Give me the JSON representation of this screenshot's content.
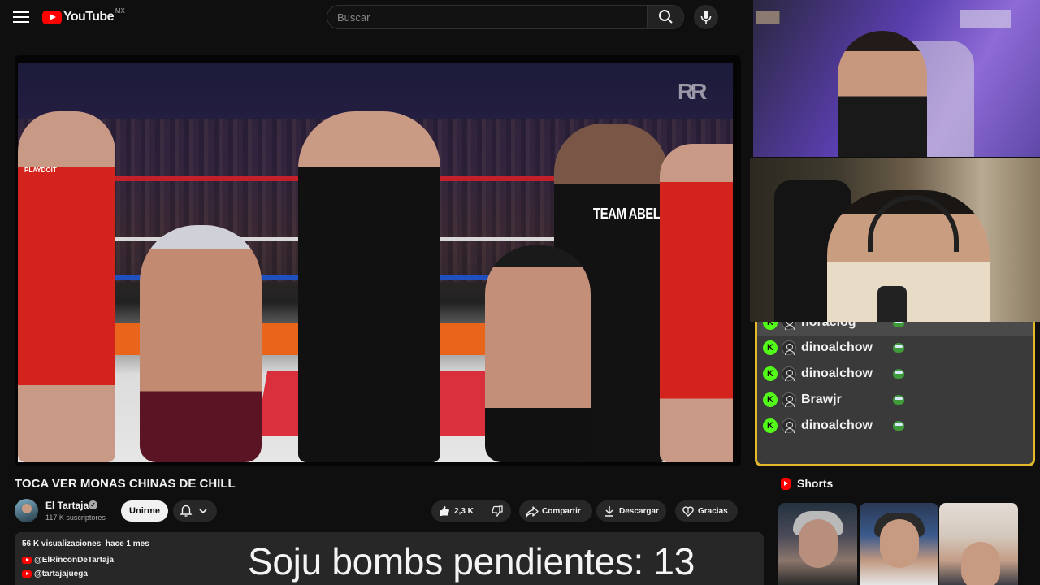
{
  "header": {
    "logo_text": "YouTube",
    "logo_country": "MX",
    "search_placeholder": "Buscar"
  },
  "video": {
    "team_shirt_text": "TEAM ABELITO",
    "mat_brand": "PLAYDOIT"
  },
  "title": "TOCA VER MONAS CHINAS DE CHILL",
  "channel": {
    "name": "El Tartaja",
    "subscribers": "117 K suscriptores",
    "join_label": "Unirme"
  },
  "actions": {
    "likes": "2,3 K",
    "share": "Compartir",
    "download": "Descargar",
    "thanks": "Gracias"
  },
  "description": {
    "views": "56 K visualizaciones",
    "date": "hace 1 mes",
    "links": [
      "@ElRinconDeTartaja",
      "@tartajajuega"
    ]
  },
  "overlay_text": "Soju bombs pendientes: 13",
  "chat": {
    "partial_user": "horaciog",
    "messages": [
      {
        "user": "dinoalchow"
      },
      {
        "user": "dinoalchow"
      },
      {
        "user": "Brawjr"
      },
      {
        "user": "dinoalchow"
      }
    ],
    "border_color": "#e3b92a",
    "kick_color": "#53fc18"
  },
  "shorts": {
    "title": "Shorts"
  },
  "colors": {
    "brand_red": "#ff0000",
    "background": "#0f0f0f"
  }
}
